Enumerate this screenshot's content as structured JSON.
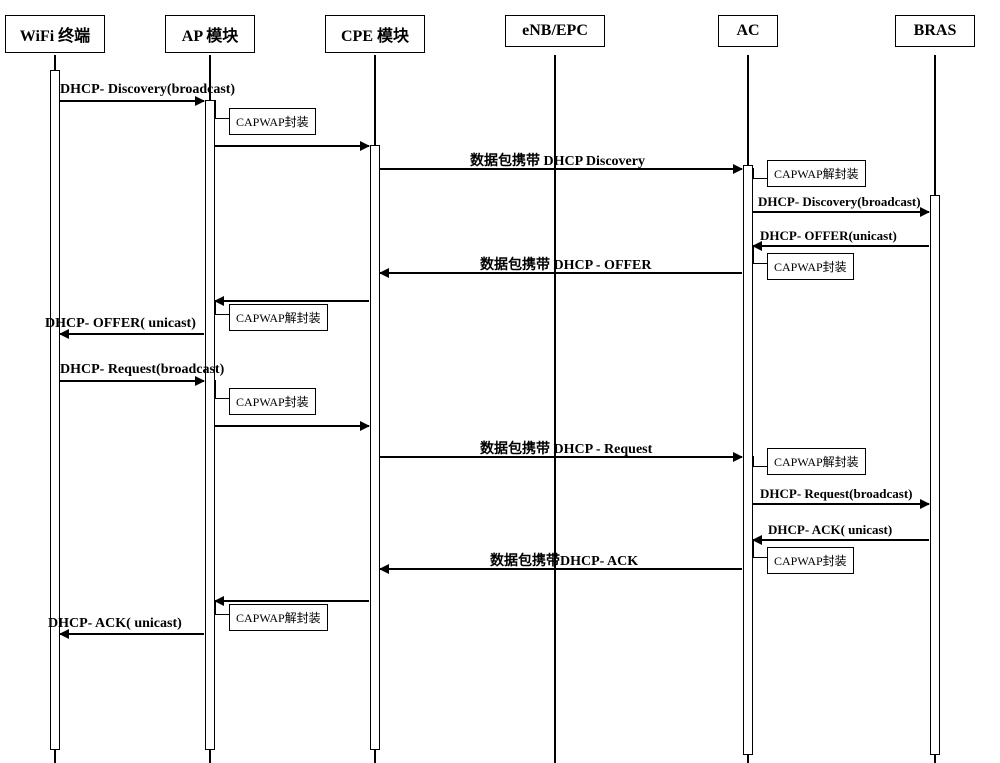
{
  "participants": {
    "wifi": "WiFi 终端",
    "ap": "AP 模块",
    "cpe": "CPE 模块",
    "enb": "eNB/EPC",
    "ac": "AC",
    "bras": "BRAS"
  },
  "messages": {
    "m1": "DHCP- Discovery(broadcast)",
    "m2": "数据包携带 DHCP  Discovery",
    "m3": "DHCP- Discovery(broadcast)",
    "m4": "DHCP- OFFER(unicast)",
    "m5": "数据包携带 DHCP - OFFER",
    "m6": "DHCP- OFFER( unicast)",
    "m7": "DHCP- Request(broadcast)",
    "m8": "数据包携带 DHCP - Request",
    "m9": "DHCP- Request(broadcast)",
    "m10": "DHCP- ACK( unicast)",
    "m11": "数据包携带DHCP- ACK",
    "m12": "DHCP- ACK( unicast)"
  },
  "notes": {
    "encap": "CAPWAP封装",
    "decap": "CAPWAP解封装"
  }
}
